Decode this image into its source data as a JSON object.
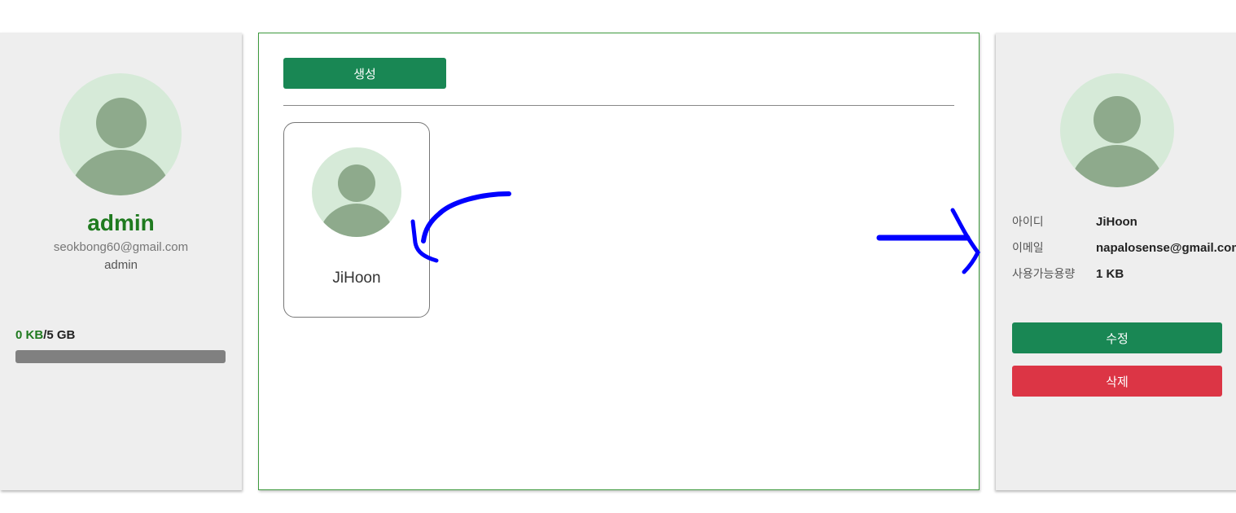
{
  "profile": {
    "name": "admin",
    "email": "seokbong60@gmail.com",
    "role": "admin",
    "storage_used": "0 KB",
    "storage_total": "/5 GB",
    "storage_fraction": 0
  },
  "main": {
    "create_label": "생성",
    "users": [
      {
        "name": "JiHoon"
      }
    ]
  },
  "detail": {
    "id_label": "아이디",
    "id_value": "JiHoon",
    "email_label": "이메일",
    "email_value": "napalosense@gmail.com",
    "usage_label": "사용가능용량",
    "usage_value": "1 KB",
    "edit_label": "수정",
    "delete_label": "삭제"
  },
  "colors": {
    "accent_green": "#198754",
    "danger_red": "#dc3545",
    "annotation_blue": "#0000ff"
  },
  "icons": {
    "avatar": "user-avatar-icon"
  }
}
